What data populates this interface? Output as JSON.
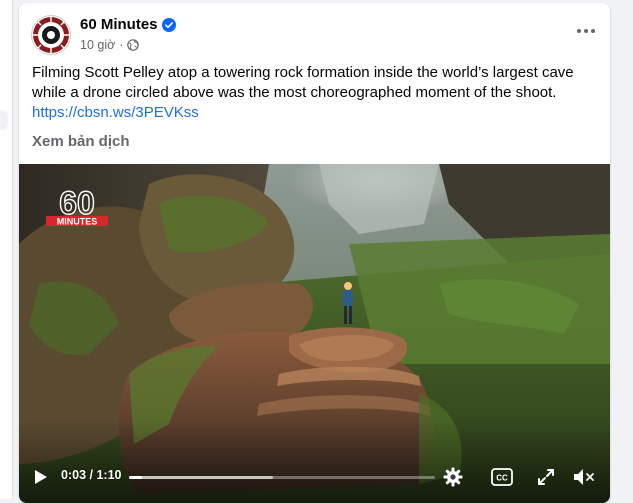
{
  "post": {
    "author": "60 Minutes",
    "time": "10 giờ",
    "separator": "·",
    "caption": "Filming Scott Pelley atop a towering rock formation inside the world’s largest cave while a drone circled above was the most choreographed moment of the shoot.",
    "link": "https://cbsn.ws/3PEVKss",
    "translate_label": "Xem bản dịch",
    "more_icon": "more-horizontal-icon",
    "privacy_icon": "globe-icon",
    "verified_icon": "verified-badge-icon"
  },
  "video": {
    "watermark_number": "60",
    "watermark_text": "MINUTES",
    "current_time": "0:03",
    "time_separator": " / ",
    "duration": "1:10",
    "played_fraction": 0.043,
    "buffered_fraction": 0.47,
    "icons": [
      "play-icon",
      "settings-icon",
      "captions-icon",
      "fullscreen-icon",
      "volume-muted-icon"
    ],
    "captions_label": "CC"
  },
  "colors": {
    "brand_blue": "#0866ff",
    "link": "#216fdb",
    "secondary_text": "#65676b",
    "watermark_red": "#d7262c"
  }
}
